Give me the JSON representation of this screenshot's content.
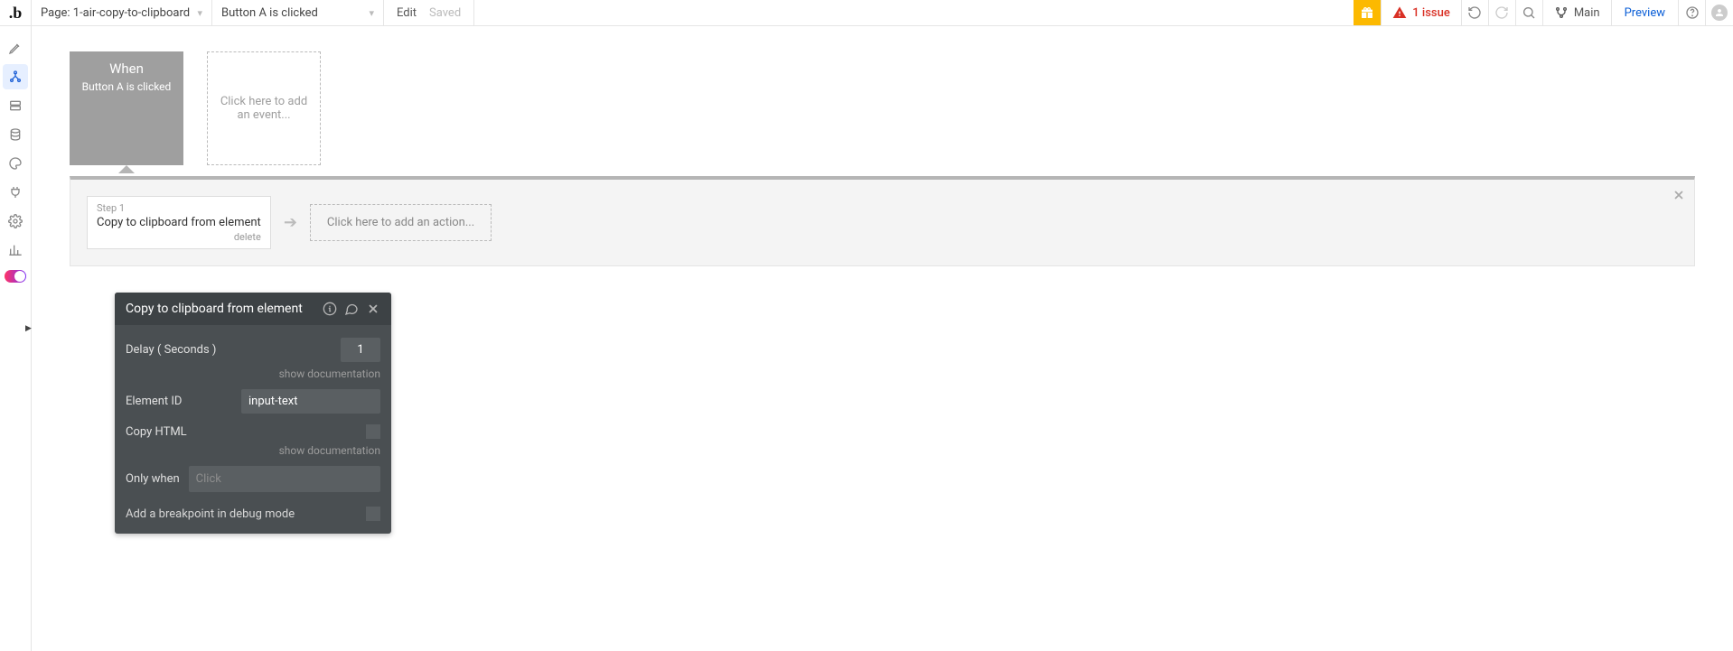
{
  "topbar": {
    "page_label_prefix": "Page:",
    "page_name": "1-air-copy-to-clipboard",
    "event_selector": "Button A is clicked",
    "mode_edit": "Edit",
    "mode_saved": "Saved",
    "issue_count_label": "1 issue",
    "branch_label": "Main",
    "preview_label": "Preview"
  },
  "events": {
    "when_label": "When",
    "when_desc": "Button A is clicked",
    "add_event_placeholder": "Click here to add an event..."
  },
  "actions": {
    "step_label": "Step 1",
    "step_title": "Copy to clipboard from element",
    "step_delete": "delete",
    "add_action_placeholder": "Click here to add an action..."
  },
  "panel": {
    "title": "Copy to clipboard from element",
    "delay_label": "Delay ( Seconds )",
    "delay_value": "1",
    "show_doc": "show documentation",
    "element_id_label": "Element ID",
    "element_id_value": "input-text",
    "copy_html_label": "Copy HTML",
    "only_when_label": "Only when",
    "only_when_placeholder": "Click",
    "breakpoint_label": "Add a breakpoint in debug mode"
  }
}
